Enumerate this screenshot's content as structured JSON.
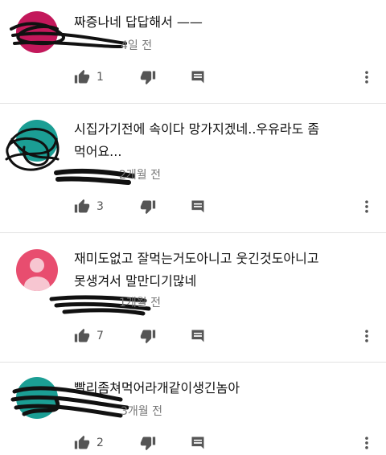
{
  "comments": [
    {
      "text": "짜증나네 답답해서 ——",
      "time": "4일 전",
      "likes": "1",
      "avatar_color": "#c3185b"
    },
    {
      "text": "시집가기전에 속이다 망가지겠네..우유라도 좀\n먹어요...",
      "time": "2개월 전",
      "likes": "3",
      "avatar_color": "#1b9e94"
    },
    {
      "text": "재미도없고 잘먹는거도아니고 웃긴것도아니고\n못생겨서 말만디기많네",
      "time": "1개월 전",
      "likes": "7",
      "avatar_color": "#e84d6f"
    },
    {
      "text": "빨리좀쳐먹어라개같이생긴놈아",
      "time": "3개월 전",
      "likes": "2",
      "avatar_color": "#1b9e94"
    }
  ],
  "icons": {
    "like": "thumbs-up-icon",
    "dislike": "thumbs-down-icon",
    "reply": "comment-icon",
    "more": "more-vert-icon"
  }
}
